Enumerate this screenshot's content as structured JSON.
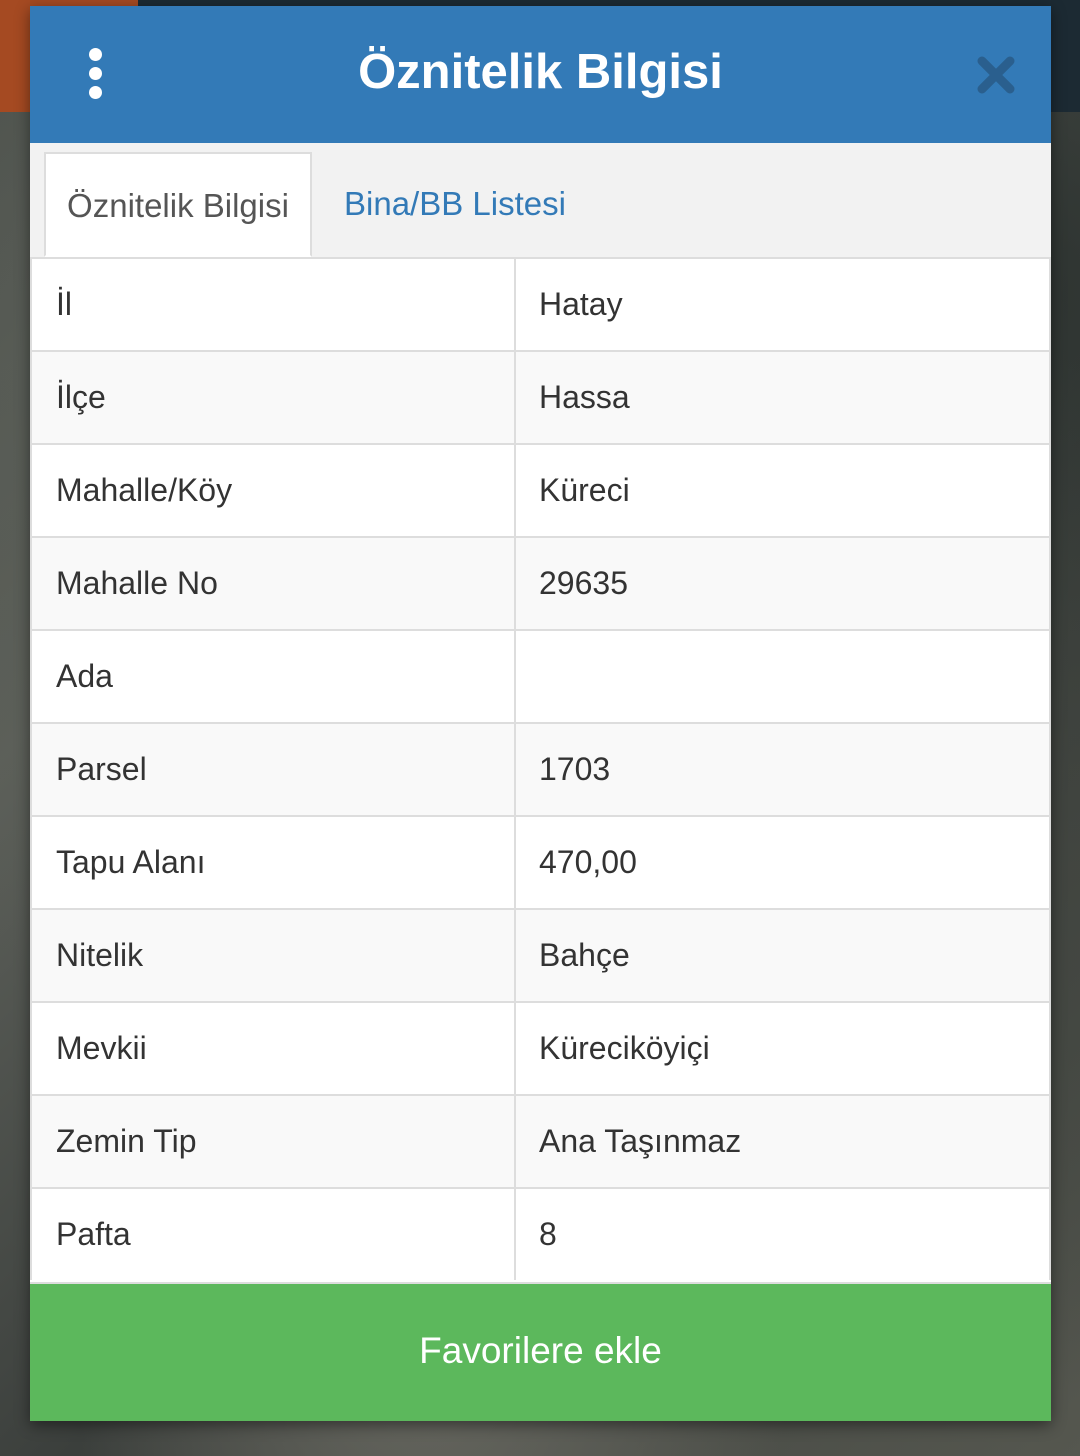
{
  "header": {
    "title": "Öznitelik Bilgisi"
  },
  "tabs": [
    {
      "label": "Öznitelik Bilgisi",
      "active": true
    },
    {
      "label": "Bina/BB Listesi",
      "active": false
    }
  ],
  "attributes": [
    {
      "label": "İl",
      "value": "Hatay"
    },
    {
      "label": "İlçe",
      "value": "Hassa"
    },
    {
      "label": "Mahalle/Köy",
      "value": "Küreci"
    },
    {
      "label": "Mahalle No",
      "value": "29635"
    },
    {
      "label": "Ada",
      "value": ""
    },
    {
      "label": "Parsel",
      "value": "1703"
    },
    {
      "label": "Tapu Alanı",
      "value": "470,00"
    },
    {
      "label": "Nitelik",
      "value": "Bahçe"
    },
    {
      "label": "Mevkii",
      "value": "Küreciköyiçi"
    },
    {
      "label": "Zemin Tip",
      "value": "Ana Taşınmaz"
    },
    {
      "label": "Pafta",
      "value": "8"
    }
  ],
  "footer": {
    "favorite_button_label": "Favorilere ekle"
  },
  "colors": {
    "header": "#337ab7",
    "link": "#337ab7",
    "button": "#5cb85c"
  },
  "icons": {
    "menu": "vertical-dots-icon",
    "close": "close-icon"
  }
}
